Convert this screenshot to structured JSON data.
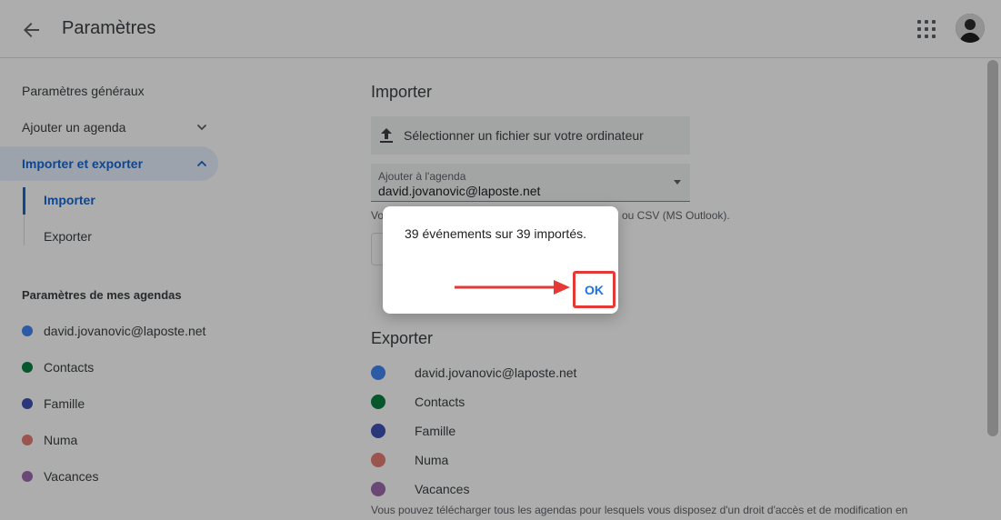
{
  "header": {
    "title": "Paramètres"
  },
  "sidebar": {
    "general": "Paramètres généraux",
    "add_calendar": "Ajouter un agenda",
    "import_export": "Importer et exporter",
    "sub_import": "Importer",
    "sub_export": "Exporter",
    "my_calendars_title": "Paramètres de mes agendas",
    "calendars": [
      {
        "label": "david.jovanovic@laposte.net",
        "color": "#4285f4"
      },
      {
        "label": "Contacts",
        "color": "#0b8043"
      },
      {
        "label": "Famille",
        "color": "#3f51b5"
      },
      {
        "label": "Numa",
        "color": "#e67c73"
      },
      {
        "label": "Vacances",
        "color": "#9e69af"
      }
    ]
  },
  "main": {
    "import_title": "Importer",
    "file_select": "Sélectionner un fichier sur votre ordinateur",
    "add_to_calendar_label": "Ajouter à l'agenda",
    "add_to_calendar_value": "david.jovanovic@laposte.net",
    "help_left": "Vo",
    "help_right": "ou CSV (MS Outlook).",
    "export_title": "Exporter",
    "export_calendars": [
      {
        "label": "david.jovanovic@laposte.net",
        "color": "#4285f4"
      },
      {
        "label": "Contacts",
        "color": "#0b8043"
      },
      {
        "label": "Famille",
        "color": "#3f51b5"
      },
      {
        "label": "Numa",
        "color": "#e67c73"
      },
      {
        "label": "Vacances",
        "color": "#9e69af"
      }
    ],
    "bottom_text": "Vous pouvez télécharger tous les agendas pour lesquels vous disposez d'un droit d'accès et de modification en"
  },
  "dialog": {
    "message": "39 événements sur 39 importés.",
    "ok_label": "OK"
  },
  "colors": {
    "accent": "#1a73e8",
    "highlight": "#e53935"
  }
}
